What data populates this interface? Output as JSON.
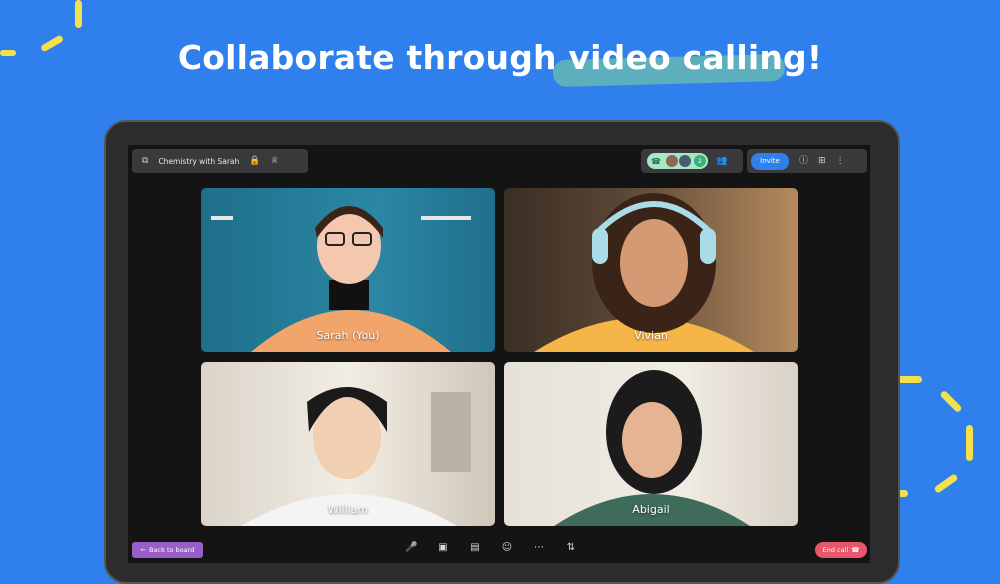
{
  "headline": "Collaborate through video calling!",
  "colors": {
    "background": "#2f80ed",
    "accent_dash": "#f4e04d",
    "invite": "#2f80ed",
    "end_call": "#e8566b",
    "back_button": "#9a5ec9"
  },
  "topbar": {
    "board_title": "Chemistry with Sarah",
    "participant_count": "2",
    "invite_label": "Invite",
    "icons": [
      "boards-icon",
      "lock-icon",
      "crown-icon",
      "phone-icon",
      "people-icon",
      "help-icon",
      "add-icon",
      "more-icon"
    ]
  },
  "participants": [
    {
      "name": "Sarah (You)"
    },
    {
      "name": "Vivian"
    },
    {
      "name": "William"
    },
    {
      "name": "Abigail"
    }
  ],
  "bottombar": {
    "back_label": "Back to board",
    "end_call_label": "End call",
    "controls": [
      "microphone-icon",
      "camera-icon",
      "screen-share-icon",
      "emoji-icon",
      "more-options-icon",
      "settings-icon"
    ]
  }
}
